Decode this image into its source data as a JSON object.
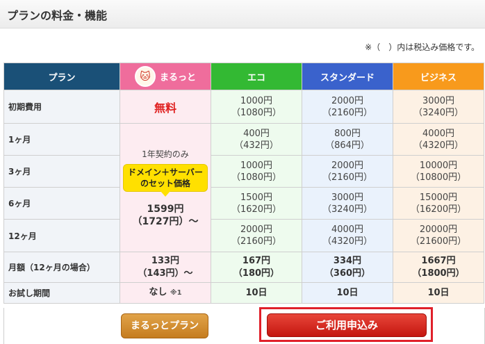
{
  "page": {
    "title": "プランの料金・機能",
    "note": "※（　）内は税込み価格です。"
  },
  "table": {
    "header": {
      "plan": "プラン",
      "maru": "まるっと",
      "eco": "エコ",
      "std": "スタンダード",
      "biz": "ビジネス"
    },
    "rows": [
      {
        "label": "初期費用",
        "eco": [
          "1000円",
          "（1080円）"
        ],
        "std": [
          "2000円",
          "（2160円）"
        ],
        "biz": [
          "3000円",
          "（3240円）"
        ]
      },
      {
        "label": "1ヶ月",
        "eco": [
          "400円",
          "（432円）"
        ],
        "std": [
          "800円",
          "（864円）"
        ],
        "biz": [
          "4000円",
          "（4320円）"
        ]
      },
      {
        "label": "3ヶ月",
        "eco": [
          "1000円",
          "（1080円）"
        ],
        "std": [
          "2000円",
          "（2160円）"
        ],
        "biz": [
          "10000円",
          "（10800円）"
        ]
      },
      {
        "label": "6ヶ月",
        "eco": [
          "1500円",
          "（1620円）"
        ],
        "std": [
          "3000円",
          "（3240円）"
        ],
        "biz": [
          "15000円",
          "（16200円）"
        ]
      },
      {
        "label": "12ヶ月",
        "eco": [
          "2000円",
          "（2160円）"
        ],
        "std": [
          "4000円",
          "（4320円）"
        ],
        "biz": [
          "20000円",
          "（21600円）"
        ]
      },
      {
        "label": "月額（12ヶ月の場合）",
        "maru": [
          "133円",
          "（143円）～"
        ],
        "eco": [
          "167円",
          "（180円）"
        ],
        "std": [
          "334円",
          "（360円）"
        ],
        "biz": [
          "1667円",
          "（1800円）"
        ]
      },
      {
        "label": "お試し期間",
        "maru": "なし",
        "maru_note": "※1",
        "eco": "10日",
        "std": "10日",
        "biz": "10日"
      }
    ],
    "maru": {
      "initial": "無料",
      "yearly": "1年契約のみ",
      "bubble_line1": "ドメイン＋サーバー",
      "bubble_line2": "のセット価格",
      "price": "1599円",
      "price_tax": "（1727円）～"
    }
  },
  "buttons": {
    "maru_plan": "まるっとプラン",
    "apply": "ご利用申込み"
  },
  "icons": {
    "maru": "cat-icon"
  },
  "colors": {
    "plan": "#1a5077",
    "maru": "#ef6d9c",
    "eco": "#33b933",
    "std": "#3a62cc",
    "biz": "#f89a1c",
    "apply": "#d42a1f"
  }
}
